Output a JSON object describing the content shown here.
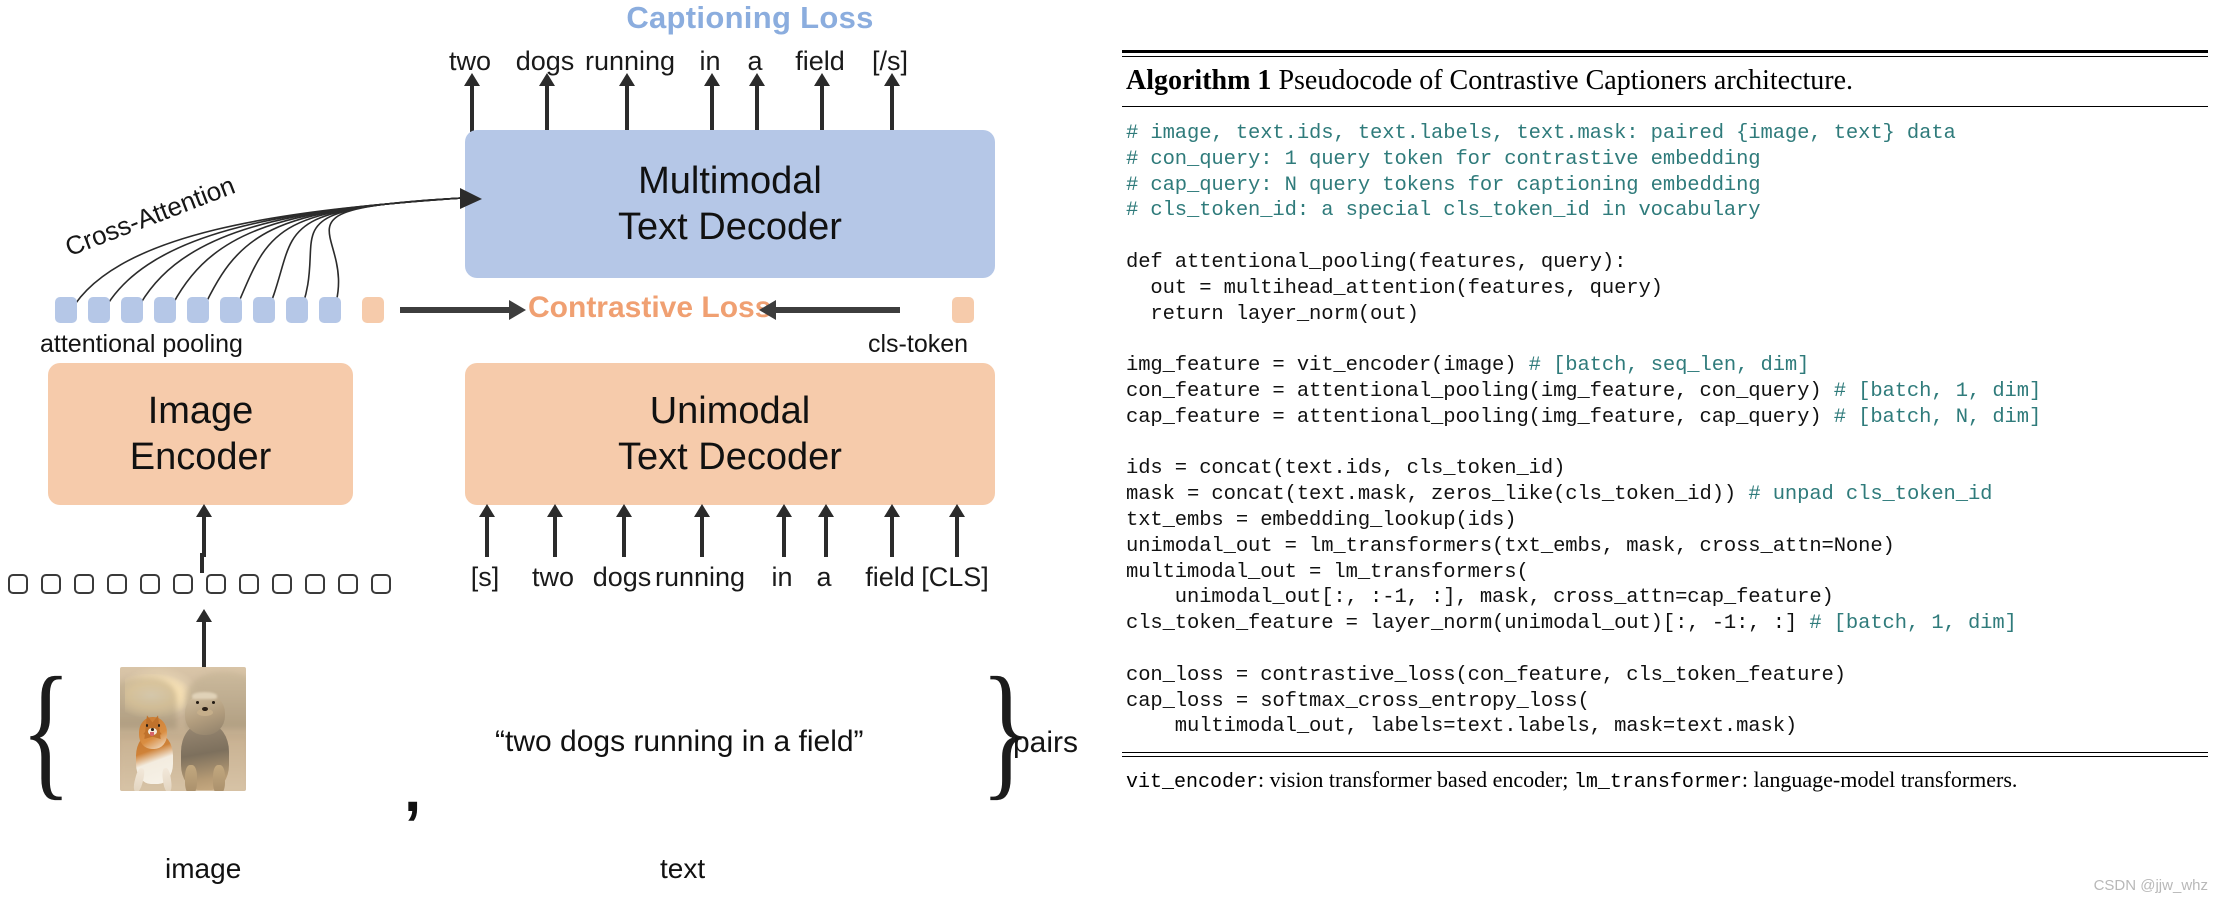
{
  "diagram": {
    "captioning_loss_label": "Captioning Loss",
    "contrastive_loss_label": "Contrastive Loss",
    "cross_attention_label": "Cross-Attention",
    "output_tokens": [
      "two",
      "dogs",
      "running",
      "in",
      "a",
      "field",
      "[/s]"
    ],
    "input_tokens": [
      "[s]",
      "two",
      "dogs",
      "running",
      "in",
      "a",
      "field",
      "[CLS]"
    ],
    "boxes": {
      "multimodal_line1": "Multimodal",
      "multimodal_line2": "Text Decoder",
      "unimodal_line1": "Unimodal",
      "unimodal_line2": "Text Decoder",
      "image_encoder_line1": "Image",
      "image_encoder_line2": "Encoder"
    },
    "attentional_pooling_label": "attentional pooling",
    "cls_token_label": "cls-token",
    "pairs_label": "pairs",
    "caption_quote": "“two dogs running in a field”",
    "comma": ",",
    "image_label": "image",
    "text_label": "text",
    "blue_square_count": 9,
    "orange_square_count": 1,
    "patch_count": 12,
    "colors": {
      "blue_fill": "#b5c7e7",
      "orange_fill": "#f6cbab",
      "captioning_loss_text": "#8badde",
      "contrastive_loss_text": "#f0a072",
      "arrow": "#3d3d3d"
    }
  },
  "algorithm": {
    "title_bold": "Algorithm 1",
    "title_rest": " Pseudocode of Contrastive Captioners architecture.",
    "code_lines": [
      {
        "segments": [
          {
            "t": "# image, text.ids, text.labels, text.mask: paired {image, text} data",
            "c": "cm"
          }
        ]
      },
      {
        "segments": [
          {
            "t": "# con_query: 1 query token for contrastive embedding",
            "c": "cm"
          }
        ]
      },
      {
        "segments": [
          {
            "t": "# cap_query: N query tokens for captioning embedding",
            "c": "cm"
          }
        ]
      },
      {
        "segments": [
          {
            "t": "# cls_token_id: a special cls_token_id in vocabulary",
            "c": "cm"
          }
        ]
      },
      {
        "segments": [
          {
            "t": "",
            "c": ""
          }
        ]
      },
      {
        "segments": [
          {
            "t": "def attentional_pooling(features, query):",
            "c": ""
          }
        ]
      },
      {
        "segments": [
          {
            "t": "  out = multihead_attention(features, query)",
            "c": ""
          }
        ]
      },
      {
        "segments": [
          {
            "t": "  return layer_norm(out)",
            "c": ""
          }
        ]
      },
      {
        "segments": [
          {
            "t": "",
            "c": ""
          }
        ]
      },
      {
        "segments": [
          {
            "t": "img_feature = vit_encoder(image) ",
            "c": ""
          },
          {
            "t": "# [batch, seq_len, dim]",
            "c": "cm"
          }
        ]
      },
      {
        "segments": [
          {
            "t": "con_feature = attentional_pooling(img_feature, con_query) ",
            "c": ""
          },
          {
            "t": "# [batch, 1, dim]",
            "c": "cm"
          }
        ]
      },
      {
        "segments": [
          {
            "t": "cap_feature = attentional_pooling(img_feature, cap_query) ",
            "c": ""
          },
          {
            "t": "# [batch, N, dim]",
            "c": "cm"
          }
        ]
      },
      {
        "segments": [
          {
            "t": "",
            "c": ""
          }
        ]
      },
      {
        "segments": [
          {
            "t": "ids = concat(text.ids, cls_token_id)",
            "c": ""
          }
        ]
      },
      {
        "segments": [
          {
            "t": "mask = concat(text.mask, zeros_like(cls_token_id)) ",
            "c": ""
          },
          {
            "t": "# unpad cls_token_id",
            "c": "cm"
          }
        ]
      },
      {
        "segments": [
          {
            "t": "txt_embs = embedding_lookup(ids)",
            "c": ""
          }
        ]
      },
      {
        "segments": [
          {
            "t": "unimodal_out = lm_transformers(txt_embs, mask, cross_attn=None)",
            "c": ""
          }
        ]
      },
      {
        "segments": [
          {
            "t": "multimodal_out = lm_transformers(",
            "c": ""
          }
        ]
      },
      {
        "segments": [
          {
            "t": "    unimodal_out[:, :-1, :], mask, cross_attn=cap_feature)",
            "c": ""
          }
        ]
      },
      {
        "segments": [
          {
            "t": "cls_token_feature = layer_norm(unimodal_out)[:, -1:, :] ",
            "c": ""
          },
          {
            "t": "# [batch, 1, dim]",
            "c": "cm"
          }
        ]
      },
      {
        "segments": [
          {
            "t": "",
            "c": ""
          }
        ]
      },
      {
        "segments": [
          {
            "t": "con_loss = contrastive_loss(con_feature, cls_token_feature)",
            "c": ""
          }
        ]
      },
      {
        "segments": [
          {
            "t": "cap_loss = softmax_cross_entropy_loss(",
            "c": ""
          }
        ]
      },
      {
        "segments": [
          {
            "t": "    multimodal_out, labels=text.labels, mask=text.mask)",
            "c": ""
          }
        ]
      }
    ],
    "footnote_parts": [
      {
        "t": "vit_encoder",
        "mono": true
      },
      {
        "t": ": vision transformer based encoder; ",
        "mono": false
      },
      {
        "t": "lm_transformer",
        "mono": true
      },
      {
        "t": ": language-model transformers.",
        "mono": false
      }
    ]
  },
  "watermark": "CSDN @jjw_whz"
}
